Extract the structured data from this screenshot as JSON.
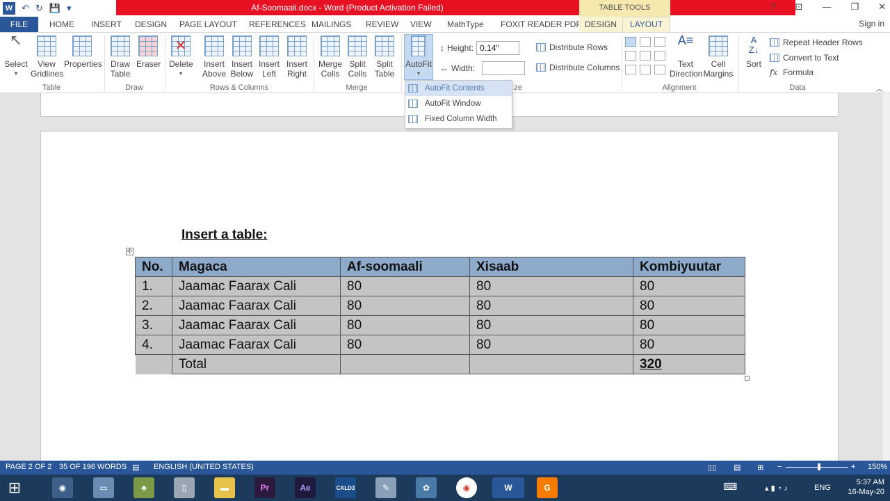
{
  "window": {
    "title": "Af-Soomaali.docx - Word (Product Activation Failed)",
    "context_tab_group": "TABLE TOOLS",
    "sign_in": "Sign in"
  },
  "qat": {
    "word_logo": "W",
    "undo": "↶",
    "redo": "↻",
    "save": "💾",
    "more": "▾"
  },
  "window_controls": {
    "help": "?",
    "ribbon_opts": "⊡",
    "minimize": "—",
    "restore": "❐",
    "close": "✕"
  },
  "tabs": {
    "file": "FILE",
    "home": "HOME",
    "insert": "INSERT",
    "design": "DESIGN",
    "page_layout": "PAGE LAYOUT",
    "references": "REFERENCES",
    "mailings": "MAILINGS",
    "review": "REVIEW",
    "view": "VIEW",
    "mathtype": "MathType",
    "foxit": "FOXIT READER PDF",
    "table_design": "DESIGN",
    "table_layout": "LAYOUT"
  },
  "ribbon": {
    "table_group": {
      "label": "Table",
      "select": "Select",
      "view_gridlines_1": "View",
      "view_gridlines_2": "Gridlines",
      "properties": "Properties"
    },
    "draw_group": {
      "label": "Draw",
      "draw_table_1": "Draw",
      "draw_table_2": "Table",
      "eraser": "Eraser"
    },
    "rows_cols_group": {
      "label": "Rows & Columns",
      "delete": "Delete",
      "insert_above_1": "Insert",
      "insert_above_2": "Above",
      "insert_below_1": "Insert",
      "insert_below_2": "Below",
      "insert_left_1": "Insert",
      "insert_left_2": "Left",
      "insert_right_1": "Insert",
      "insert_right_2": "Right"
    },
    "merge_group": {
      "label": "Merge",
      "merge_cells_1": "Merge",
      "merge_cells_2": "Cells",
      "split_cells_1": "Split",
      "split_cells_2": "Cells",
      "split_table_1": "Split",
      "split_table_2": "Table"
    },
    "cell_size_group": {
      "label_tail": "ze",
      "autofit": "AutoFit",
      "height_label": "Height:",
      "height_value": "0.14\"",
      "width_label": "Width:",
      "width_value": "",
      "distribute_rows": "Distribute Rows",
      "distribute_columns": "Distribute Columns"
    },
    "alignment_group": {
      "label": "Alignment",
      "text_direction_1": "Text",
      "text_direction_2": "Direction",
      "cell_margins_1": "Cell",
      "cell_margins_2": "Margins"
    },
    "data_group": {
      "label": "Data",
      "sort": "Sort",
      "repeat_header_rows": "Repeat Header Rows",
      "convert_to_text": "Convert to Text",
      "formula": "Formula"
    }
  },
  "autofit_menu": {
    "items": [
      "AutoFit Contents",
      "AutoFit Window",
      "Fixed Column Width"
    ]
  },
  "document": {
    "heading": "Insert a table:",
    "table": {
      "headers": [
        "No.",
        "Magaca",
        "Af-soomaali",
        "Xisaab",
        "Kombiyuutar"
      ],
      "rows": [
        [
          "1.",
          "Jaamac Faarax Cali",
          "80",
          "80",
          "80"
        ],
        [
          "2.",
          "Jaamac Faarax Cali",
          "80",
          "80",
          "80"
        ],
        [
          "3.",
          "Jaamac Faarax Cali",
          "80",
          "80",
          "80"
        ],
        [
          "4.",
          "Jaamac Faarax Cali",
          "80",
          "80",
          "80"
        ]
      ],
      "total_label": "Total",
      "total_value": "320"
    }
  },
  "statusbar": {
    "page": "PAGE 2 OF 2",
    "words": "35 OF 196 WORDS",
    "language": "ENGLISH (UNITED STATES)",
    "zoom": "150%"
  },
  "taskbar": {
    "start": "⊞",
    "apps": [
      "Pr",
      "Ae",
      "CALD3",
      "W"
    ],
    "lang": "ENG",
    "time": "5:37 AM",
    "date": "16-May-20"
  },
  "colors": {
    "accent": "#2b579a",
    "title_red": "#e81123",
    "header_cell": "#8eaacb",
    "cell_shading": "#c4c4c4"
  }
}
